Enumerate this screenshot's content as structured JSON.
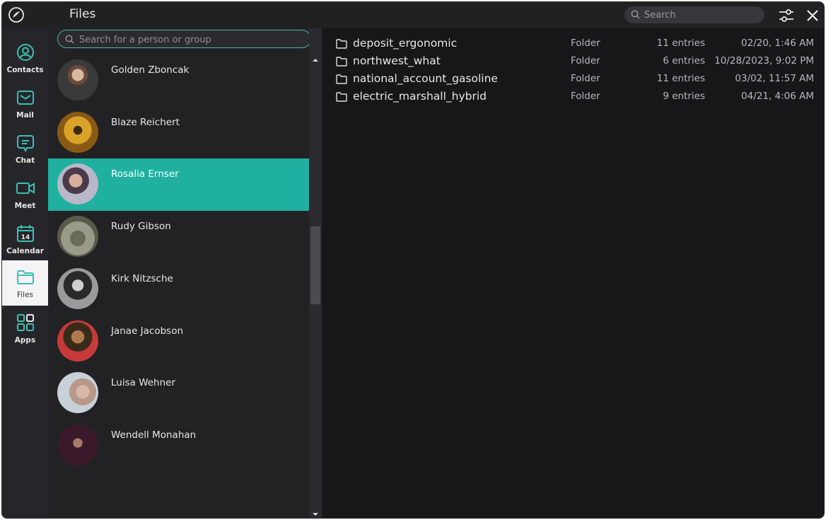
{
  "header": {
    "title": "Files",
    "search_placeholder": "Search"
  },
  "nav": {
    "items": [
      {
        "label": "Contacts",
        "icon": "contacts-icon"
      },
      {
        "label": "Mail",
        "icon": "mail-icon"
      },
      {
        "label": "Chat",
        "icon": "chat-icon"
      },
      {
        "label": "Meet",
        "icon": "video-icon"
      },
      {
        "label": "Calendar",
        "icon": "calendar-icon",
        "badge": "14"
      },
      {
        "label": "Files",
        "icon": "folder-icon",
        "active": true
      },
      {
        "label": "Apps",
        "icon": "apps-grid-icon"
      }
    ]
  },
  "contacts": {
    "search_placeholder": "Search for a person or group",
    "selected": "Rosalia Ernser",
    "items": [
      {
        "name": "Golden Zboncak"
      },
      {
        "name": "Blaze Reichert"
      },
      {
        "name": "Rosalia Ernser"
      },
      {
        "name": "Rudy Gibson"
      },
      {
        "name": "Kirk Nitzsche"
      },
      {
        "name": "Janae Jacobson"
      },
      {
        "name": "Luisa Wehner"
      },
      {
        "name": "Wendell Monahan"
      }
    ]
  },
  "files": {
    "rows": [
      {
        "name": "deposit_ergonomic",
        "type": "Folder",
        "entries": "11 entries",
        "modified": "02/20, 1:46 AM"
      },
      {
        "name": "northwest_what",
        "type": "Folder",
        "entries": "6 entries",
        "modified": "10/28/2023, 9:02 PM"
      },
      {
        "name": "national_account_gasoline",
        "type": "Folder",
        "entries": "11 entries",
        "modified": "03/02, 11:57 AM"
      },
      {
        "name": "electric_marshall_hybrid",
        "type": "Folder",
        "entries": "9 entries",
        "modified": "04/21, 4:06 AM"
      }
    ]
  },
  "colors": {
    "accent": "#20b0a0",
    "background": "#17171a",
    "panel": "#222225"
  }
}
